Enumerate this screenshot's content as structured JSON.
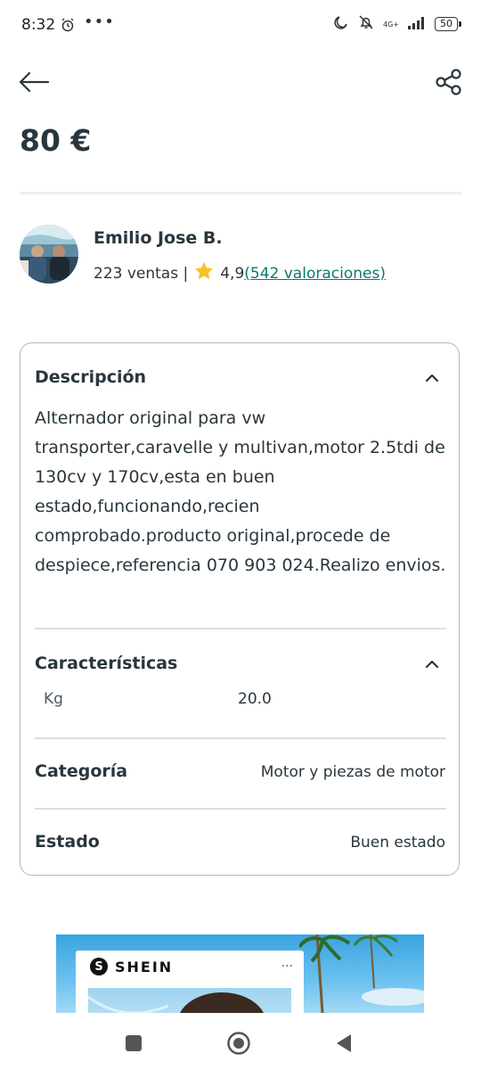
{
  "status_bar": {
    "time": "8:32",
    "overflow_dots": "•••",
    "network": "4G+",
    "battery": "50",
    "icons": [
      "alarm-icon",
      "moon-icon",
      "bell-off-icon",
      "signal-icon",
      "battery-icon"
    ]
  },
  "product": {
    "price": "80 €"
  },
  "seller": {
    "name": "Emilio Jose B.",
    "sales": "223 ventas |",
    "rating": "4,9",
    "reviews": "(542 valoraciones)"
  },
  "details": {
    "description_title": "Descripción",
    "description_text": "Alternador original para vw transporter,caravelle y multivan,motor 2.5tdi de 130cv y 170cv,esta en buen estado,funcionando,recien comprobado.producto original,procede de despiece,referencia 070 903 024.Realizo envios.",
    "characteristics_title": "Características",
    "kg_label": "Kg",
    "kg_value": "20.0",
    "category_label": "Categoría",
    "category_value": "Motor y piezas de motor",
    "state_label": "Estado",
    "state_value": "Buen estado"
  },
  "ad": {
    "brand": "SHEIN",
    "logo_letter": "S",
    "menu": "..."
  },
  "colors": {
    "text": "#29363d",
    "link": "#0a7a6c",
    "star": "#f8c22b",
    "border": "#a9bcc3"
  }
}
